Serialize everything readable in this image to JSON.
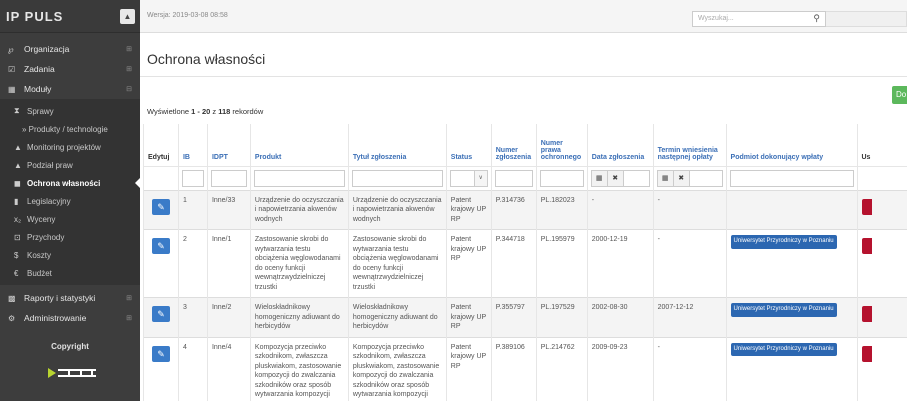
{
  "app": {
    "logo_text": "IP PULS",
    "version": "Wersja: 2019-03-08 08:58"
  },
  "search": {
    "placeholder": "Wyszukaj..."
  },
  "sidebar": {
    "items": [
      {
        "label": "Organizacja",
        "icon": "org-icon"
      },
      {
        "label": "Zadania",
        "icon": "tasks-icon"
      },
      {
        "label": "Moduły",
        "icon": "modules-icon"
      }
    ],
    "submenu": [
      {
        "label": "Sprawy",
        "icon": "cases-icon"
      },
      {
        "label": "» Produkty / technologie",
        "icon": ""
      },
      {
        "label": "Monitoring projektów",
        "icon": "monitoring-icon"
      },
      {
        "label": "Podział praw",
        "icon": "rights-icon"
      },
      {
        "label": "Ochrona własności",
        "icon": "shield-icon",
        "active": true
      },
      {
        "label": "Legislacyjny",
        "icon": "legislation-icon"
      },
      {
        "label": "Wyceny",
        "icon": "valuation-icon"
      },
      {
        "label": "Przychody",
        "icon": "income-icon"
      },
      {
        "label": "Koszty",
        "icon": "dollar-icon"
      },
      {
        "label": "Budżet",
        "icon": "euro-icon"
      }
    ],
    "items_bottom": [
      {
        "label": "Raporty i statystyki",
        "icon": "reports-icon"
      },
      {
        "label": "Administrowanie",
        "icon": "admin-icon"
      }
    ],
    "copyright": "Copyright"
  },
  "main": {
    "title": "Ochrona własności",
    "add_button": "Do",
    "records": {
      "prefix": "Wyświetlone ",
      "range": "1 - 20",
      "middle": " z ",
      "total": "118",
      "suffix": " rekordów"
    }
  },
  "table": {
    "headers": {
      "edit": "Edytuj",
      "ib": "IB",
      "idpt": "IDPT",
      "product": "Produkt",
      "title": "Tytuł zgłoszenia",
      "status": "Status",
      "app_no": "Numer zgłoszenia",
      "right_no": "Numer prawa ochronnego",
      "app_date": "Data zgłoszenia",
      "next_fee": "Termin wniesienia następnej opłaty",
      "payer": "Podmiot dokonujący wpłaty",
      "delete": "Us"
    },
    "rows": [
      {
        "ib": "1",
        "idpt": "Inne/33",
        "product": "Urządzenie do oczyszczania i napowietrzania akwenów wodnych",
        "title": "Urządzenie do oczyszczania i napowietrzania akwenów wodnych",
        "status": "Patent krajowy UP RP",
        "app_no": "P.314736",
        "right_no": "PL.182023",
        "app_date": "-",
        "next_fee": "-",
        "payer": ""
      },
      {
        "ib": "2",
        "idpt": "Inne/1",
        "product": "Zastosowanie skrobi do wytwarzania testu obciążenia węglowodanami do oceny funkcji wewnątrzwydzielniczej trzustki",
        "title": "Zastosowanie skrobi do wytwarzania testu obciążenia węglowodanami do oceny funkcji wewnątrzwydzielniczej trzustki",
        "status": "Patent krajowy UP RP",
        "app_no": "P.344718",
        "right_no": "PL.195979",
        "app_date": "2000-12-19",
        "next_fee": "-",
        "payer": "Uniwersytet Przyrodniczy w Poznaniu"
      },
      {
        "ib": "3",
        "idpt": "Inne/2",
        "product": "Wieloskładnikowy homogeniczny adiuwant do herbicydów",
        "title": "Wieloskładnikowy homogeniczny adiuwant do herbicydów",
        "status": "Patent krajowy UP RP",
        "app_no": "P.355797",
        "right_no": "PL.197529",
        "app_date": "2002-08-30",
        "next_fee": "2007-12-12",
        "payer": "Uniwersytet Przyrodniczy w Poznaniu"
      },
      {
        "ib": "4",
        "idpt": "Inne/4",
        "product": "Kompozycja przeciwko szkodnikom, zwłaszcza pluskwiakom, zastosowanie kompozycji do zwalczania szkodników oraz sposób wytwarzania kompozycji",
        "title": "Kompozycja przeciwko szkodnikom, zwłaszcza pluskwiakom, zastosowanie kompozycji do zwalczania szkodników oraz sposób wytwarzania kompozycji",
        "status": "Patent krajowy UP RP",
        "app_no": "P.389106",
        "right_no": "PL.214762",
        "app_date": "2009-09-23",
        "next_fee": "-",
        "payer": "Uniwersytet Przyrodniczy w Poznaniu"
      }
    ]
  },
  "colors": {
    "sidebar": "#3d3d3d",
    "link": "#3b6fb6",
    "edit": "#3a7bc8",
    "add": "#5cb85c",
    "delete": "#b5122e"
  }
}
